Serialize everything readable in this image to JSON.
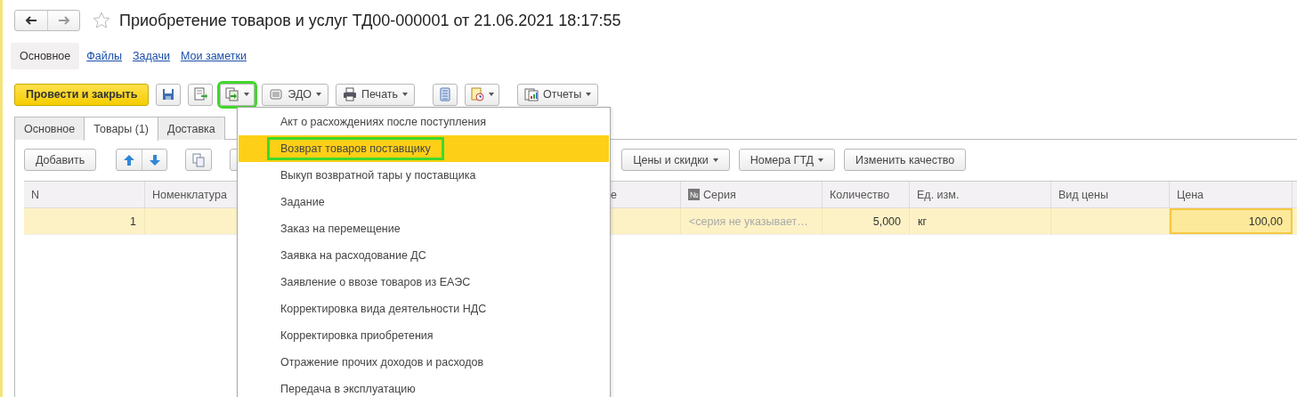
{
  "title": "Приобретение товаров и услуг ТД00-000001 от 21.06.2021 18:17:55",
  "sections": [
    {
      "label": "Основное",
      "selected": true
    },
    {
      "label": "Файлы",
      "selected": false
    },
    {
      "label": "Задачи",
      "selected": false
    },
    {
      "label": "Мои заметки",
      "selected": false
    }
  ],
  "command_bar": [
    {
      "kind": "primary",
      "label": "Провести и закрыть",
      "annotated": false
    },
    {
      "kind": "icon",
      "annotated": false
    },
    {
      "kind": "icon",
      "annotated": false
    },
    {
      "kind": "icon-menu",
      "annotated": true
    },
    {
      "kind": "text-menu",
      "label": "ЭДО",
      "annotated": false
    },
    {
      "kind": "text-menu",
      "label": "Печать",
      "annotated": false
    },
    {
      "kind": "icon",
      "annotated": false
    },
    {
      "kind": "icon-menu",
      "annotated": false
    },
    {
      "kind": "text-menu",
      "label": "Отчеты",
      "annotated": false
    }
  ],
  "tabs": [
    {
      "label": "Основное",
      "selected": false
    },
    {
      "label": "Товары (1)",
      "selected": true
    },
    {
      "label": "Доставка",
      "selected": false
    }
  ],
  "table_toolbar": {
    "left": [
      {
        "kind": "text",
        "label": "Добавить"
      },
      {
        "kind": "arrows"
      },
      {
        "kind": "icon"
      },
      {
        "kind": "covered"
      }
    ],
    "right": [
      {
        "kind": "text-menu",
        "label": "Цены и скидки"
      },
      {
        "kind": "text-menu",
        "label": "Номера ГТД"
      },
      {
        "kind": "text",
        "label": "Изменить качество"
      }
    ]
  },
  "table": {
    "columns": [
      {
        "label": "N"
      },
      {
        "label": "Номенклатура"
      },
      {
        "label": "е"
      },
      {
        "label": "Серия",
        "badge": "№"
      },
      {
        "label": "Количество"
      },
      {
        "label": "Ед. изм."
      },
      {
        "label": "Вид цены"
      },
      {
        "label": "Цена"
      }
    ],
    "rows": [
      {
        "selected": true,
        "cells": [
          {
            "text": "1",
            "numeric": true,
            "muted": false,
            "selected": false
          },
          null,
          null,
          {
            "text": "<серия не указывает…",
            "numeric": false,
            "muted": true,
            "selected": false
          },
          {
            "text": "5,000",
            "numeric": true,
            "muted": false,
            "selected": false
          },
          {
            "text": "кг",
            "numeric": false,
            "muted": false,
            "selected": false
          },
          null,
          {
            "text": "100,00",
            "numeric": true,
            "muted": false,
            "selected": true
          }
        ]
      }
    ]
  },
  "menu": {
    "items": [
      {
        "label": "Акт о расхождениях после поступления",
        "selected": false,
        "annotated": false
      },
      {
        "label": "Возврат товаров поставщику",
        "selected": true,
        "annotated": true
      },
      {
        "label": "Выкуп возвратной тары у поставщика",
        "selected": false,
        "annotated": false
      },
      {
        "label": "Задание",
        "selected": false,
        "annotated": false
      },
      {
        "label": "Заказ на перемещение",
        "selected": false,
        "annotated": false
      },
      {
        "label": "Заявка на расходование ДС",
        "selected": false,
        "annotated": false
      },
      {
        "label": "Заявление о ввозе товаров из ЕАЭС",
        "selected": false,
        "annotated": false
      },
      {
        "label": "Корректировка вида деятельности НДС",
        "selected": false,
        "annotated": false
      },
      {
        "label": "Корректировка приобретения",
        "selected": false,
        "annotated": false
      },
      {
        "label": "Отражение прочих доходов и расходов",
        "selected": false,
        "annotated": false
      },
      {
        "label": "Передача в эксплуатацию",
        "selected": false,
        "annotated": false
      }
    ]
  }
}
